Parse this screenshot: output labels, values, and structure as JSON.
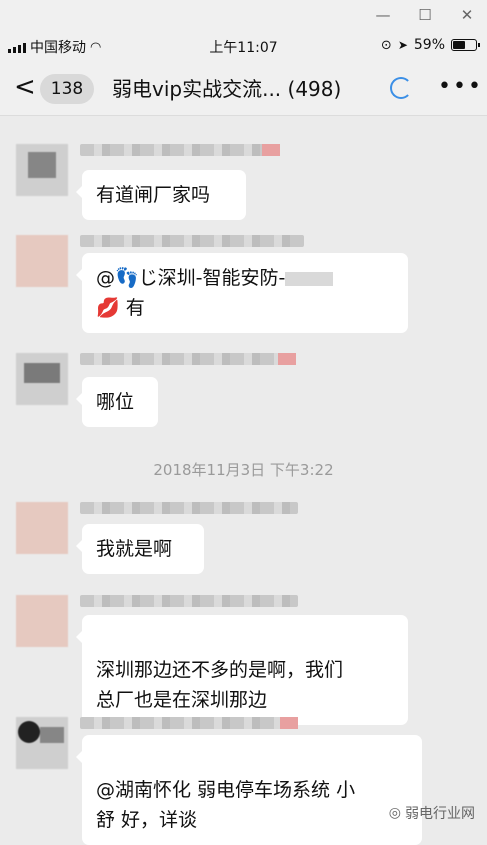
{
  "status": {
    "carrier": "中国移动",
    "time": "上午11:07",
    "battery": "59%",
    "battery_level": 0.59
  },
  "nav": {
    "back_badge": "138",
    "title": "弱电vip实战交流... (498)"
  },
  "messages": [
    {
      "text": "有道闸厂家吗"
    },
    {
      "line1_prefix": "@👣じ深圳-智能安防-",
      "line2": "💋 有"
    },
    {
      "text": "哪位"
    },
    {
      "text": "我就是啊"
    },
    {
      "text": "深圳那边还不多的是啊，我们\n总厂也是在深圳那边"
    },
    {
      "text": "@湖南怀化 弱电停车场系统 小\n舒 好，详谈"
    }
  ],
  "timestamp": "2018年11月3日 下午3:22",
  "watermark": "弱电行业网",
  "icons": [
    "minimize-icon",
    "maximize-icon",
    "close-icon",
    "wifi-icon",
    "location-icon",
    "back-chevron-icon",
    "loading-icon",
    "more-icon"
  ]
}
